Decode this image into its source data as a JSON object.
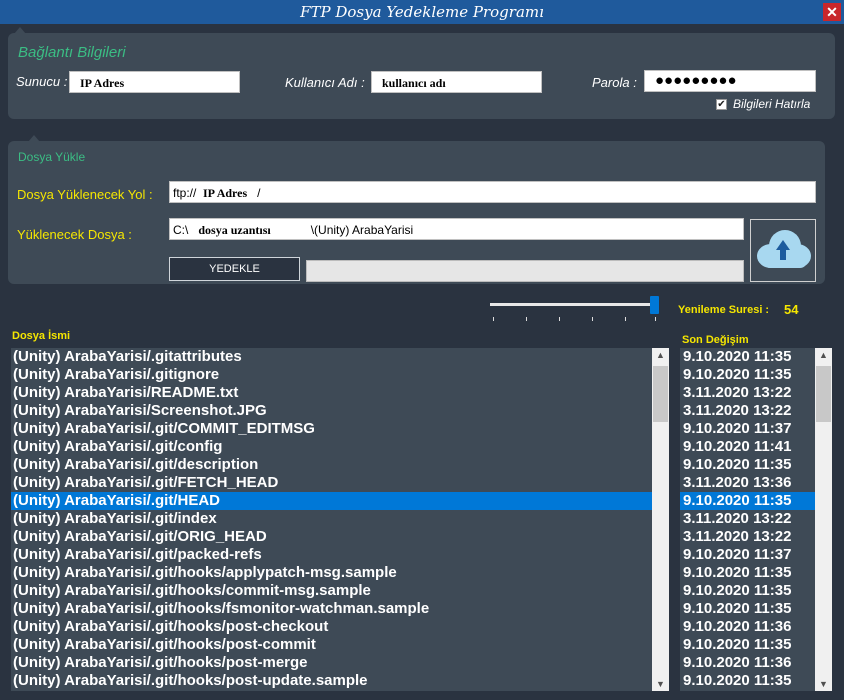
{
  "window": {
    "title": "FTP Dosya Yedekleme Programı",
    "close_label": "✕"
  },
  "connection": {
    "group_title": "Bağlantı Bilgileri",
    "server_label": "Sunucu :",
    "server_value": "IP Adres",
    "user_label": "Kullanıcı Adı :",
    "user_value": "kullanıcı adı",
    "password_label": "Parola :",
    "password_value": "●●●●●●●●●",
    "remember_label": "Bilgileri Hatırla",
    "remember_checked": true
  },
  "upload": {
    "group_title": "Dosya Yükle",
    "path_label": "Dosya Yüklenecek Yol :",
    "path_prefix": "ftp://  ",
    "path_bold": "IP Adres",
    "path_suffix": "   /",
    "file_label": "Yüklenecek Dosya :",
    "file_prefix": "C:\\   ",
    "file_bold": "dosya uzantısı",
    "file_suffix": "            \\(Unity) ArabaYarisi",
    "backup_button": "YEDEKLE",
    "progress": 0,
    "upload_icon": "cloud-upload-icon"
  },
  "refresh": {
    "label": "Yenileme Suresi :",
    "value": "54",
    "slider_position": 1.0
  },
  "files": {
    "name_header": "Dosya İsmi",
    "date_header": "Son Değişim",
    "selected_index": 8,
    "rows": [
      {
        "name": "(Unity) ArabaYarisi/.gitattributes",
        "date": "9.10.2020 11:35"
      },
      {
        "name": "(Unity) ArabaYarisi/.gitignore",
        "date": "9.10.2020 11:35"
      },
      {
        "name": "(Unity) ArabaYarisi/README.txt",
        "date": "3.11.2020 13:22"
      },
      {
        "name": "(Unity) ArabaYarisi/Screenshot.JPG",
        "date": "3.11.2020 13:22"
      },
      {
        "name": "(Unity) ArabaYarisi/.git/COMMIT_EDITMSG",
        "date": "9.10.2020 11:37"
      },
      {
        "name": "(Unity) ArabaYarisi/.git/config",
        "date": "9.10.2020 11:41"
      },
      {
        "name": "(Unity) ArabaYarisi/.git/description",
        "date": "9.10.2020 11:35"
      },
      {
        "name": "(Unity) ArabaYarisi/.git/FETCH_HEAD",
        "date": "3.11.2020 13:36"
      },
      {
        "name": "(Unity) ArabaYarisi/.git/HEAD",
        "date": "9.10.2020 11:35"
      },
      {
        "name": "(Unity) ArabaYarisi/.git/index",
        "date": "3.11.2020 13:22"
      },
      {
        "name": "(Unity) ArabaYarisi/.git/ORIG_HEAD",
        "date": "3.11.2020 13:22"
      },
      {
        "name": "(Unity) ArabaYarisi/.git/packed-refs",
        "date": "9.10.2020 11:37"
      },
      {
        "name": "(Unity) ArabaYarisi/.git/hooks/applypatch-msg.sample",
        "date": "9.10.2020 11:35"
      },
      {
        "name": "(Unity) ArabaYarisi/.git/hooks/commit-msg.sample",
        "date": "9.10.2020 11:35"
      },
      {
        "name": "(Unity) ArabaYarisi/.git/hooks/fsmonitor-watchman.sample",
        "date": "9.10.2020 11:35"
      },
      {
        "name": "(Unity) ArabaYarisi/.git/hooks/post-checkout",
        "date": "9.10.2020 11:36"
      },
      {
        "name": "(Unity) ArabaYarisi/.git/hooks/post-commit",
        "date": "9.10.2020 11:35"
      },
      {
        "name": "(Unity) ArabaYarisi/.git/hooks/post-merge",
        "date": "9.10.2020 11:36"
      },
      {
        "name": "(Unity) ArabaYarisi/.git/hooks/post-update.sample",
        "date": "9.10.2020 11:35"
      }
    ]
  },
  "colors": {
    "background": "#2a3340",
    "panel": "#3e4a56",
    "accent_green": "#3bbd84",
    "label_yellow": "#f5e600",
    "selection": "#0078d7",
    "titlebar": "#1f5a9c"
  }
}
